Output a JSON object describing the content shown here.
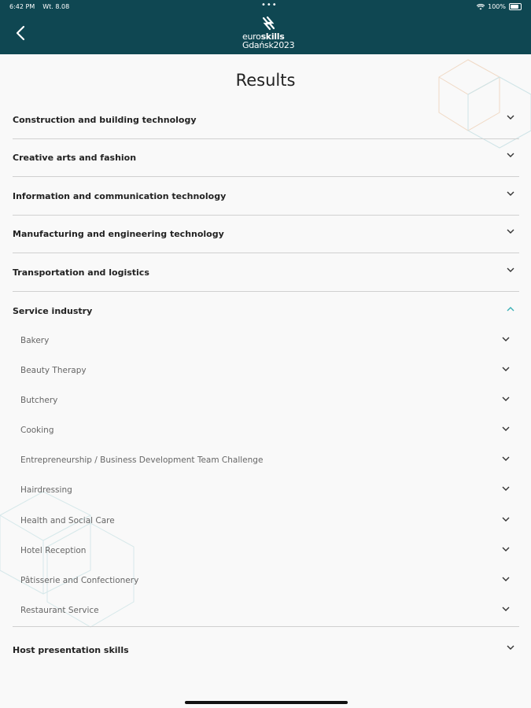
{
  "status_bar": {
    "time": "6:42 PM",
    "date": "Wt. 8.08",
    "dots": "•••",
    "battery_percent": "100%"
  },
  "header": {
    "logo_line1_prefix": "euro",
    "logo_line1_bold": "skills",
    "logo_line2": "Gdańsk2023",
    "brand_color": "#0f4752"
  },
  "page": {
    "title": "Results"
  },
  "categories": [
    {
      "label": "Construction and building technology",
      "expanded": false
    },
    {
      "label": "Creative arts and fashion",
      "expanded": false
    },
    {
      "label": "Information and communication technology",
      "expanded": false
    },
    {
      "label": "Manufacturing and engineering technology",
      "expanded": false
    },
    {
      "label": "Transportation and logistics",
      "expanded": false
    },
    {
      "label": "Service industry",
      "expanded": true
    },
    {
      "label": "Host presentation skills",
      "expanded": false
    }
  ],
  "service_items": [
    "Bakery",
    "Beauty Therapy",
    "Butchery",
    "Cooking",
    "Entrepreneurship / Business Development Team Challenge",
    "Hairdressing",
    "Health and Social Care",
    "Hotel Reception",
    "Pâtisserie and Confectionery",
    "Restaurant Service"
  ],
  "colors": {
    "accent": "#3ab0b5",
    "divider": "#d0d0d0"
  }
}
